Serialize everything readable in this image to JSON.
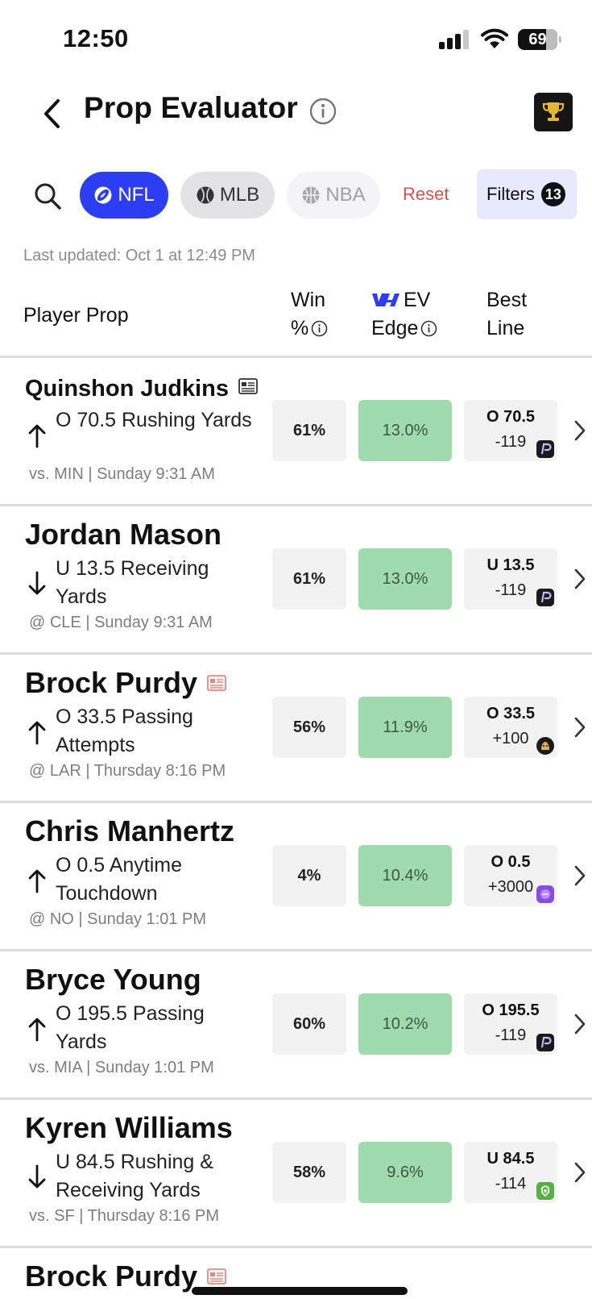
{
  "status_bar": {
    "time": "12:50",
    "battery": "69"
  },
  "header": {
    "title": "Prop Evaluator"
  },
  "filters": {
    "sports": [
      {
        "label": "NFL",
        "icon": "football-icon",
        "active": true
      },
      {
        "label": "MLB",
        "icon": "baseball-icon",
        "active": false
      },
      {
        "label": "NBA",
        "icon": "basketball-icon",
        "active": false
      }
    ],
    "reset_label": "Reset",
    "filters_label": "Filters",
    "filters_count": "13"
  },
  "last_updated": "Last updated: Oct 1 at 12:49 PM",
  "table_header": {
    "player_prop": "Player Prop",
    "win_line1": "Win",
    "win_line2": "%",
    "ev_line1": "EV",
    "ev_line2": "Edge",
    "best_line1": "Best",
    "best_line2": "Line"
  },
  "rows": [
    {
      "player": "Quinshon Judkins",
      "direction": "up",
      "prop": "O 70.5 Rushing Yards",
      "game": "vs. MIN | Sunday 9:31 AM",
      "win": "61%",
      "ev": "13.0%",
      "best_line": "O 70.5",
      "best_odds": "-119",
      "book": "prizepicks",
      "news": true,
      "news_color": "#333333"
    },
    {
      "player": "Jordan Mason",
      "direction": "down",
      "prop": "U 13.5 Receiving Yards",
      "game": "@ CLE | Sunday 9:31 AM",
      "win": "61%",
      "ev": "13.0%",
      "best_line": "U 13.5",
      "best_odds": "-119",
      "book": "prizepicks",
      "news": false
    },
    {
      "player": "Brock Purdy",
      "direction": "up",
      "prop": "O 33.5 Passing Attempts",
      "game": "@ LAR | Thursday 8:16 PM",
      "win": "56%",
      "ev": "11.9%",
      "best_line": "O 33.5",
      "best_odds": "+100",
      "book": "underdog",
      "news": true,
      "news_color": "#e8867f"
    },
    {
      "player": "Chris Manhertz",
      "direction": "up",
      "prop": "O 0.5 Anytime Touchdown",
      "game": "@ NO | Sunday 1:01 PM",
      "win": "4%",
      "ev": "10.4%",
      "best_line": "O 0.5",
      "best_odds": "+3000",
      "book": "hardrock",
      "news": false
    },
    {
      "player": "Bryce Young",
      "direction": "up",
      "prop": "O 195.5 Passing Yards",
      "game": "vs. MIA | Sunday 1:01 PM",
      "win": "60%",
      "ev": "10.2%",
      "best_line": "O 195.5",
      "best_odds": "-119",
      "book": "prizepicks",
      "news": false
    },
    {
      "player": "Kyren Williams",
      "direction": "down",
      "prop": "U 84.5 Rushing & Receiving Yards",
      "game": "vs. SF | Thursday 8:16 PM",
      "win": "58%",
      "ev": "9.6%",
      "best_line": "U 84.5",
      "best_odds": "-114",
      "book": "draftkings",
      "news": false
    }
  ],
  "partial_row": {
    "player": "Brock Purdy"
  },
  "colors": {
    "accent": "#2d3ef2",
    "ev_green": "#9fdbac",
    "reset_red": "#d9544f",
    "trophy_gold": "#e5b636"
  }
}
